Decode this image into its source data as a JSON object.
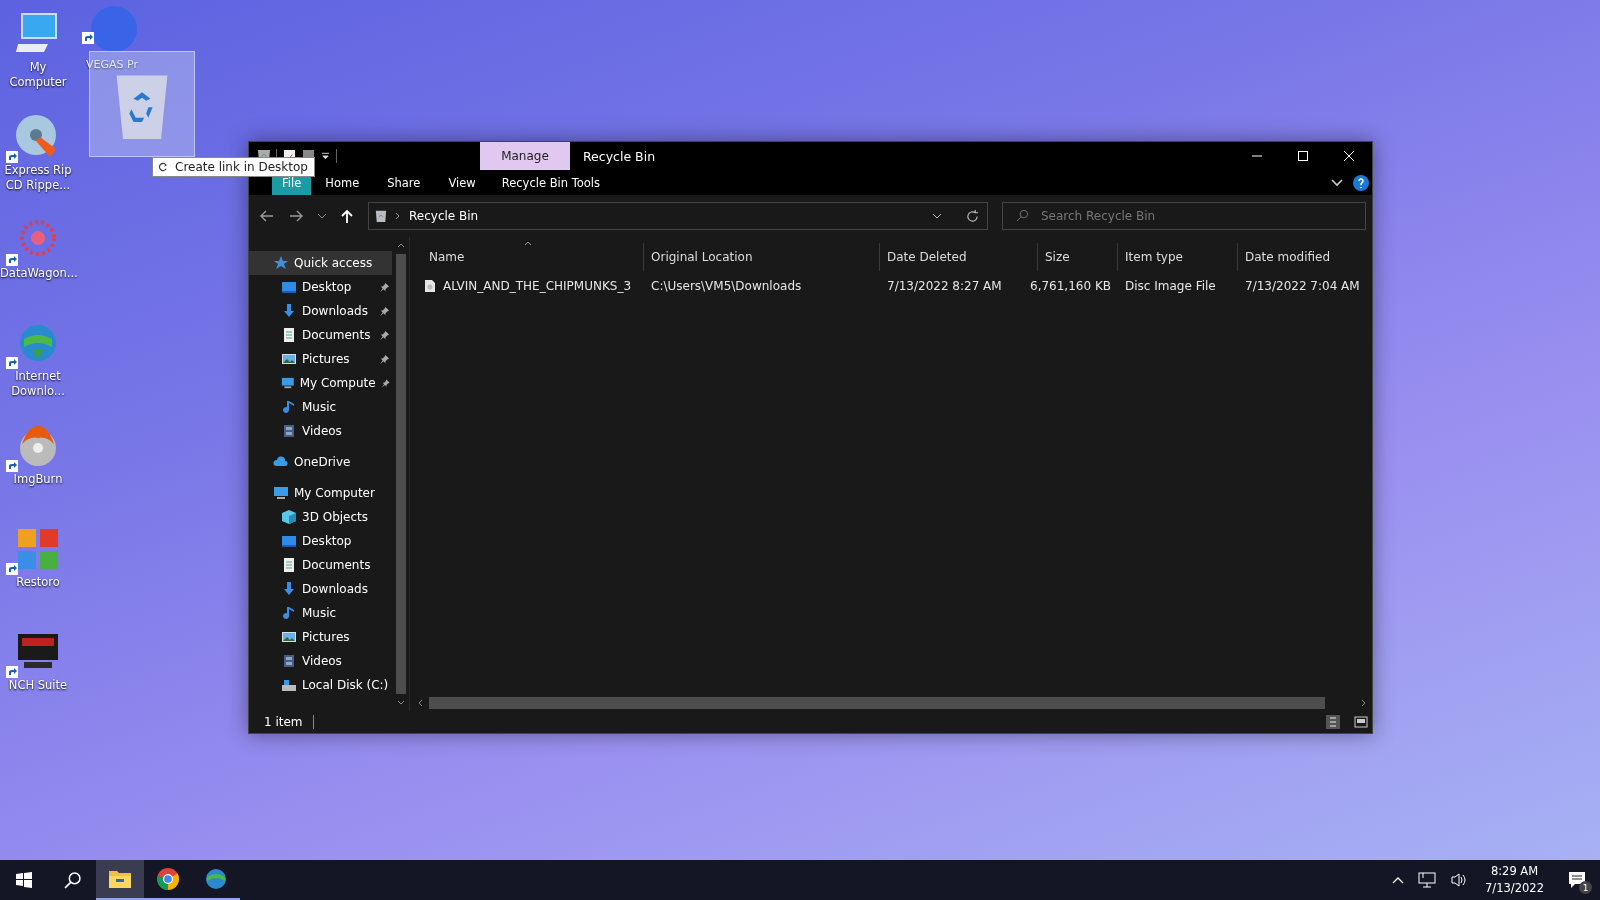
{
  "desktop_icons": [
    {
      "label": "My Computer",
      "kind": "computer",
      "shortcut": false
    },
    {
      "label": "Express Rip CD Rippe...",
      "kind": "disc",
      "shortcut": true
    },
    {
      "label": "DataWagon...",
      "kind": "burst",
      "shortcut": true
    },
    {
      "label": "Internet Downlo...",
      "kind": "globe",
      "shortcut": true
    },
    {
      "label": "ImgBurn",
      "kind": "flame",
      "shortcut": true
    },
    {
      "label": "Restoro",
      "kind": "blocks",
      "shortcut": true
    },
    {
      "label": "NCH Suite",
      "kind": "nch",
      "shortcut": true
    }
  ],
  "partly_hidden_icon": {
    "label": "VEGAS Pr",
    "shortcut": true
  },
  "drag_tooltip": {
    "text": "Create link in Desktop"
  },
  "window": {
    "title": "Recycle Bin",
    "contextual_tab": "Manage",
    "ribbon_tabs": [
      {
        "label": "File",
        "kind": "file"
      },
      {
        "label": "Home",
        "kind": "tab"
      },
      {
        "label": "Share",
        "kind": "tab"
      },
      {
        "label": "View",
        "kind": "tab"
      },
      {
        "label": "Recycle Bin Tools",
        "kind": "contextual"
      }
    ],
    "address": {
      "path": "Recycle Bin"
    },
    "search": {
      "placeholder": "Search Recycle Bin"
    },
    "navigation": [
      {
        "label": "Quick access",
        "kind": "star",
        "selected": true,
        "children": [
          {
            "label": "Desktop",
            "kind": "desktop",
            "pinned": true
          },
          {
            "label": "Downloads",
            "kind": "download",
            "pinned": true
          },
          {
            "label": "Documents",
            "kind": "document",
            "pinned": true
          },
          {
            "label": "Pictures",
            "kind": "picture",
            "pinned": true
          },
          {
            "label": "My Compute",
            "kind": "computer",
            "pinned": true
          },
          {
            "label": "Music",
            "kind": "music",
            "pinned": false
          },
          {
            "label": "Videos",
            "kind": "video",
            "pinned": false
          }
        ]
      },
      {
        "label": "OneDrive",
        "kind": "cloud",
        "selected": false
      },
      {
        "label": "My Computer",
        "kind": "computer",
        "selected": false,
        "children": [
          {
            "label": "3D Objects",
            "kind": "cube",
            "pinned": false
          },
          {
            "label": "Desktop",
            "kind": "desktop",
            "pinned": false
          },
          {
            "label": "Documents",
            "kind": "document",
            "pinned": false
          },
          {
            "label": "Downloads",
            "kind": "download",
            "pinned": false
          },
          {
            "label": "Music",
            "kind": "music",
            "pinned": false
          },
          {
            "label": "Pictures",
            "kind": "picture",
            "pinned": false
          },
          {
            "label": "Videos",
            "kind": "video",
            "pinned": false
          },
          {
            "label": "Local Disk (C:)",
            "kind": "disk",
            "pinned": false
          }
        ]
      }
    ],
    "columns": [
      {
        "label": "Name",
        "sorted": true
      },
      {
        "label": "Original Location",
        "sorted": false
      },
      {
        "label": "Date Deleted",
        "sorted": false
      },
      {
        "label": "Size",
        "sorted": false
      },
      {
        "label": "Item type",
        "sorted": false
      },
      {
        "label": "Date modified",
        "sorted": false
      }
    ],
    "rows": [
      {
        "cells": [
          "ALVIN_AND_THE_CHIPMUNKS_3",
          "C:\\Users\\VM5\\Downloads",
          "7/13/2022 8:27 AM",
          "6,761,160 KB",
          "Disc Image File",
          "7/13/2022 7:04 AM"
        ]
      }
    ],
    "status_bar": {
      "item_count": "1 item"
    }
  },
  "taskbar": {
    "apps": [
      {
        "kind": "explorer",
        "active": true
      },
      {
        "kind": "chrome",
        "active": false
      },
      {
        "kind": "globe",
        "active": false
      }
    ],
    "time": "8:29 AM",
    "date": "7/13/2022",
    "notification_count": "1"
  }
}
